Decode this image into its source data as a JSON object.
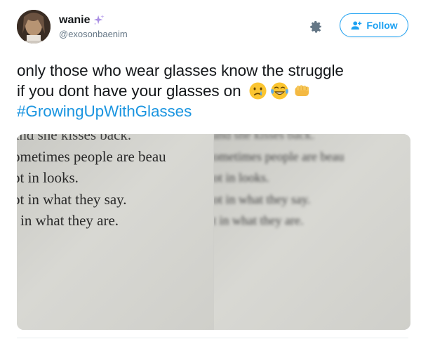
{
  "user": {
    "display_name": "wanie",
    "handle": "@exosonbaenim"
  },
  "actions": {
    "follow_label": "Follow",
    "settings_icon": "gear-icon",
    "follow_icon": "add-user-icon"
  },
  "tweet": {
    "line1": "only those who wear glasses know the struggle",
    "line2": "if you dont have your glasses on",
    "emojis": [
      "crying-face",
      "tears-of-joy",
      "oncoming-fist"
    ],
    "hashtag": "#GrowingUpWithGlasses"
  },
  "photos": [
    {
      "state": "sharp",
      "lines": [
        "and she kisses back.",
        "ometimes people are beau",
        "ot in looks.",
        "ot in what they say.",
        "t in what they are."
      ]
    },
    {
      "state": "blurred",
      "lines": [
        "and she kisses back.",
        "ometimes people are beau",
        "ot in looks.",
        "ot in what they say.",
        "t in what they are."
      ]
    }
  ],
  "colors": {
    "accent": "#1da1f2",
    "hashtag": "#1b95e0",
    "text": "#14171a",
    "secondary": "#657786"
  }
}
